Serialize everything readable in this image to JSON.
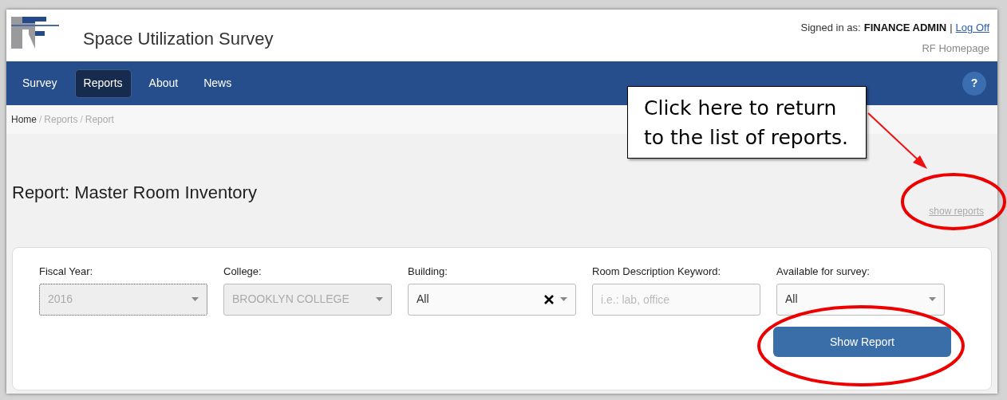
{
  "header": {
    "title": "Space Utilization Survey",
    "signed_in_label": "Signed in as:",
    "user": "FINANCE ADMIN",
    "separator": "|",
    "log_off": "Log Off",
    "homepage": "RF Homepage"
  },
  "nav": {
    "tabs": [
      {
        "label": "Survey",
        "selected": false
      },
      {
        "label": "Reports",
        "selected": true
      },
      {
        "label": "About",
        "selected": false
      },
      {
        "label": "News",
        "selected": false
      }
    ],
    "help": "?"
  },
  "breadcrumb": {
    "separator": "/",
    "items": [
      {
        "label": "Home",
        "current": false
      },
      {
        "label": "Reports",
        "current": true
      },
      {
        "label": "Report",
        "current": true
      }
    ]
  },
  "page_title": "Report: Master Room Inventory",
  "show_reports": "show reports",
  "filters": [
    {
      "kind": "select",
      "label": "Fiscal Year:",
      "value": "2016",
      "disabled": true,
      "focused": true,
      "clearable": false
    },
    {
      "kind": "select",
      "label": "College:",
      "value": "BROOKLYN COLLEGE",
      "disabled": true,
      "focused": false,
      "clearable": false
    },
    {
      "kind": "select",
      "label": "Building:",
      "value": "All",
      "disabled": false,
      "focused": false,
      "clearable": true
    },
    {
      "kind": "text",
      "label": "Room Description Keyword:",
      "placeholder": "i.e.: lab, office",
      "disabled": false,
      "focused": false
    },
    {
      "kind": "select",
      "label": "Available for survey:",
      "value": "All",
      "disabled": false,
      "focused": false,
      "clearable": false
    }
  ],
  "show_report_button": "Show Report",
  "callout": {
    "lines": [
      "Click here to return",
      "to the list of reports."
    ]
  }
}
